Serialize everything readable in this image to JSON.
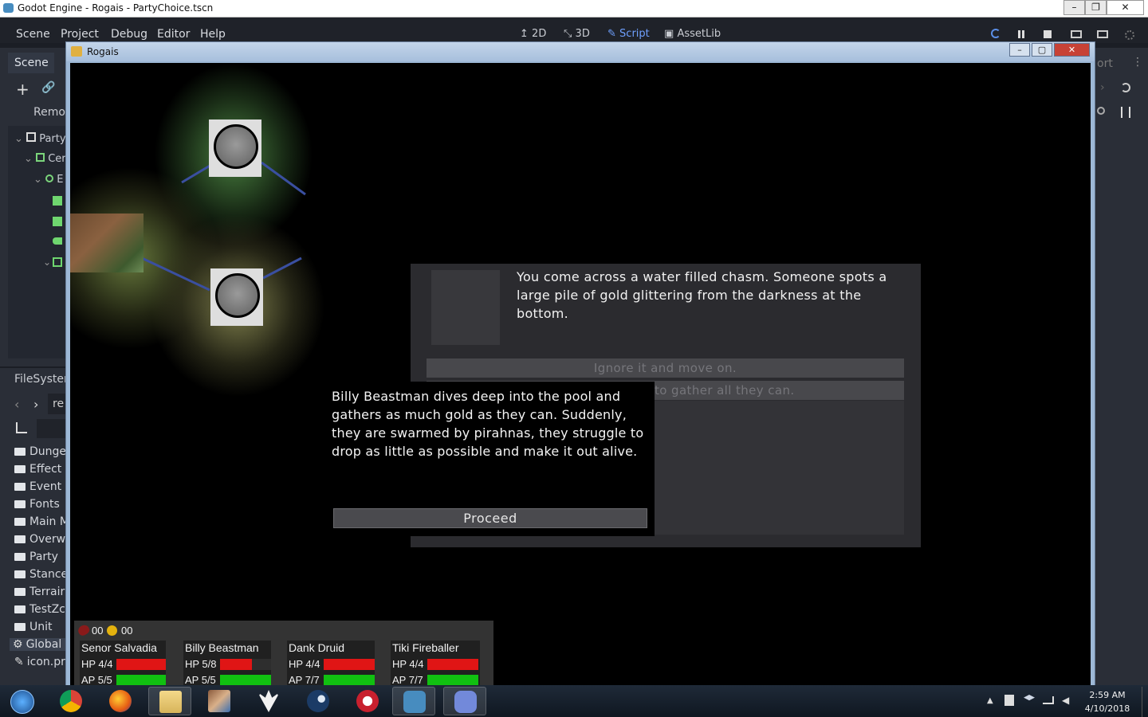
{
  "os_window": {
    "title": "Godot Engine - Rogais - PartyChoice.tscn",
    "min": "–",
    "max": "❐",
    "close": "✕"
  },
  "editor": {
    "menu": [
      "Scene",
      "Project",
      "Debug",
      "Editor",
      "Help"
    ],
    "workspaces": [
      {
        "icon": "↥",
        "label": "2D"
      },
      {
        "icon": "⤡",
        "label": "3D"
      },
      {
        "icon": "✎",
        "label": "Script"
      },
      {
        "icon": "▣",
        "label": "AssetLib"
      }
    ],
    "scene_tab": "Scene",
    "remote_label": "Remo",
    "tree": [
      "Party",
      "Cer",
      "E"
    ],
    "filesystem_tab": "FileSyster",
    "fs_path": "re",
    "fs_items": [
      "Dunge",
      "Effect",
      "Event",
      "Fonts",
      "Main M",
      "Overw",
      "Party",
      "Stance",
      "Terrair",
      "TestZc",
      "Unit",
      "Global",
      "icon.pr"
    ],
    "right_dock_label": "ort"
  },
  "game_window": {
    "title": "Rogais",
    "min": "–",
    "max": "▢",
    "close": "✕"
  },
  "event": {
    "description": "You come across a water filled chasm. Someone spots a large pile of gold glittering from the darkness at the bottom.",
    "choices": [
      "Ignore it and move on.",
      "to gather all they can."
    ]
  },
  "result": {
    "text": "Billy Beastman dives deep into the pool and gathers as much gold as they can. Suddenly, they are swarmed by pirahnas, they struggle to drop as little as possible and make it out alive.",
    "proceed_label": "Proceed"
  },
  "resources": {
    "meat": "00",
    "gold": "00"
  },
  "party": [
    {
      "name": "Senor Salvadia",
      "hp_text": "HP 4/4",
      "hp": 1.0,
      "ap_text": "AP 5/5",
      "ap": 1.0
    },
    {
      "name": "Billy Beastman",
      "hp_text": "HP 5/8",
      "hp": 0.625,
      "ap_text": "AP 5/5",
      "ap": 1.0
    },
    {
      "name": "Dank Druid",
      "hp_text": "HP 4/4",
      "hp": 1.0,
      "ap_text": "AP 7/7",
      "ap": 1.0
    },
    {
      "name": "Tiki Fireballer",
      "hp_text": "HP 4/4",
      "hp": 1.0,
      "ap_text": "AP 7/7",
      "ap": 1.0
    }
  ],
  "taskbar": {
    "apps": [
      "start-orb",
      "chrome",
      "firefox",
      "file-explorer",
      "game-avatar",
      "fox-app",
      "steam",
      "red-app",
      "godot",
      "discord"
    ],
    "time": "2:59 AM",
    "date": "4/10/2018"
  },
  "colors": {
    "hp": "#e01515",
    "ap": "#11c011",
    "accent": "#6fa0ff"
  }
}
